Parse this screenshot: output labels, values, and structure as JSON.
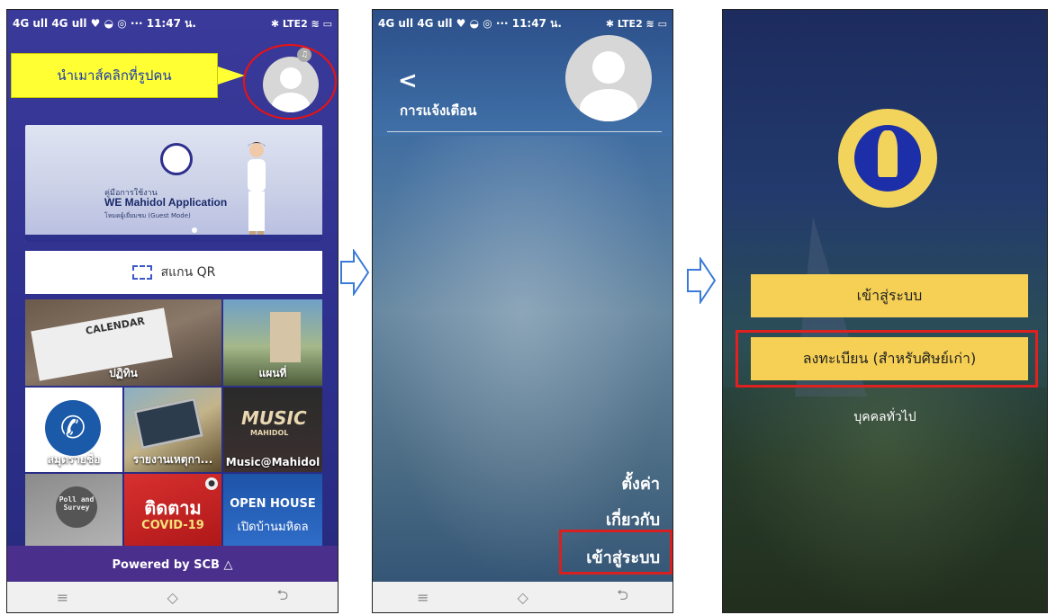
{
  "status_bar": {
    "left": "4G ull 4G ull ♥ ◒ ◎  ···  11:47 น.",
    "right": "✱ LTE2 ≋ ▭"
  },
  "phone1": {
    "callout_text": "นำเมาส์คลิกที่รูปคน",
    "banner": {
      "small_text": "คู่มือการใช้งาน",
      "title": "WE Mahidol Application",
      "subtitle": "โหมดผู้เยี่ยมชม (Guest Mode)"
    },
    "qr_label": "สแกน QR",
    "tiles": [
      {
        "label": "ปฏิทิน"
      },
      {
        "label": "แผนที่"
      },
      {
        "label": "สมุดรายชื่อ"
      },
      {
        "label": "รายงานเหตุกา..."
      },
      {
        "label": "Music@Mahidol"
      },
      {
        "label": "Poll and Survey"
      },
      {
        "label": "ติดตาม"
      },
      {
        "label": "COVID-19"
      },
      {
        "label": "OPEN HOUSE"
      },
      {
        "label": "เปิดบ้านมหิดล"
      }
    ],
    "calendar_text": "CALENDAR",
    "music_text": "MUSIC",
    "music_sub": "MAHIDOL",
    "powered_by": "Powered by SCB △",
    "nav_icons": [
      "menu-icon",
      "home-icon",
      "back-icon"
    ],
    "nav_glyphs": [
      "≡",
      "◇",
      "⮌"
    ]
  },
  "phone2": {
    "back_glyph": "<",
    "title": "การแจ้งเตือน",
    "menu": [
      "ตั้งค่า",
      "เกี่ยวกับ",
      "เข้าสู่ระบบ"
    ]
  },
  "phone3": {
    "login_button": "เข้าสู่ระบบ",
    "register_button": "ลงทะเบียน (สำหรับศิษย์เก่า)",
    "general_link": "บุคคลทั่วไป"
  },
  "colors": {
    "callout_yellow": "#ffff33",
    "highlight_red": "#e11111",
    "button_gold": "#f6d054",
    "app_blue": "#2d2f8c",
    "powered_purple": "#4a2f8c"
  }
}
